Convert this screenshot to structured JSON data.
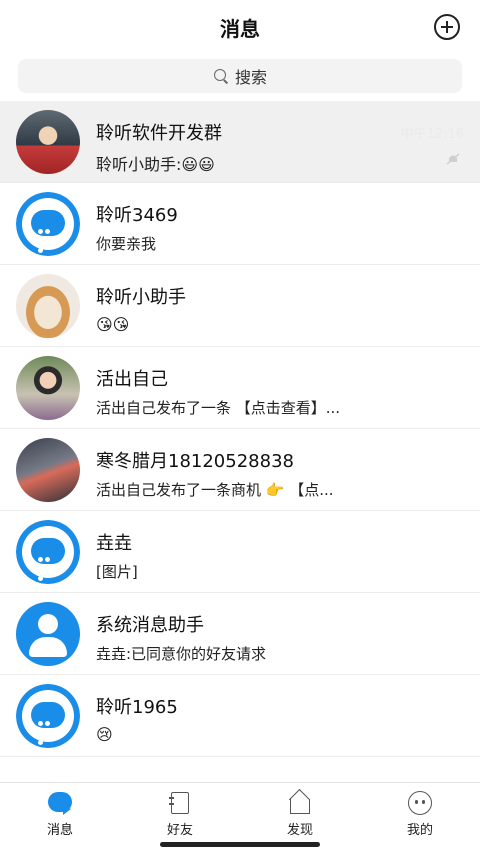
{
  "header": {
    "title": "消息"
  },
  "search": {
    "placeholder": "搜索"
  },
  "conversations": [
    {
      "name": "聆听软件开发群",
      "preview": "聆听小助手:😃😃",
      "time": "中午12:16",
      "pinned": true,
      "muted": true
    },
    {
      "name": "聆听3469",
      "preview": "你要亲我"
    },
    {
      "name": "聆听小助手",
      "preview": "😘😘"
    },
    {
      "name": "活出自己",
      "preview": "活出自己发布了一条 【点击查看】..."
    },
    {
      "name": "寒冬腊月18120528838",
      "preview": "活出自己发布了一条商机 👉 【点..."
    },
    {
      "name": "垚垚",
      "preview": "[图片]"
    },
    {
      "name": "系统消息助手",
      "preview": "垚垚:已同意你的好友请求"
    },
    {
      "name": "聆听1965",
      "preview": "😢"
    }
  ],
  "tabbar": {
    "tabs": [
      {
        "label": "消息",
        "icon": "message-icon",
        "active": true
      },
      {
        "label": "好友",
        "icon": "contacts-icon"
      },
      {
        "label": "发现",
        "icon": "discover-icon"
      },
      {
        "label": "我的",
        "icon": "profile-icon"
      }
    ]
  },
  "colors": {
    "accent": "#1a8de9",
    "pinned_bg": "#f0f0f0"
  }
}
